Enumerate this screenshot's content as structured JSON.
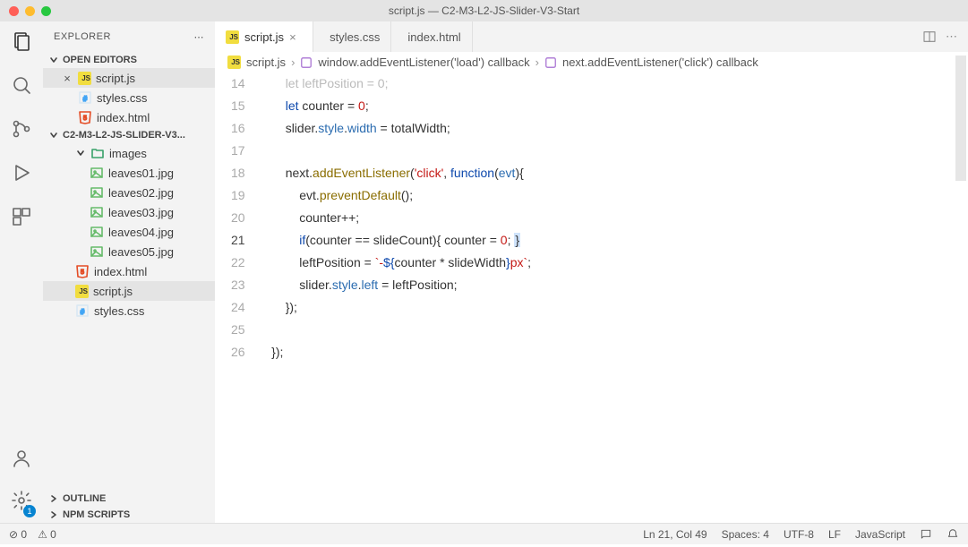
{
  "window": {
    "title": "script.js — C2-M3-L2-JS-Slider-V3-Start"
  },
  "sidebar": {
    "header": "EXPLORER",
    "openEditors": "OPEN EDITORS",
    "project": "C2-M3-L2-JS-SLIDER-V3...",
    "outline": "OUTLINE",
    "npm": "NPM SCRIPTS",
    "open": [
      {
        "name": "script.js",
        "type": "js",
        "close": true
      },
      {
        "name": "styles.css",
        "type": "css"
      },
      {
        "name": "index.html",
        "type": "html"
      }
    ],
    "tree": [
      {
        "name": "images",
        "type": "folder",
        "depth": 2,
        "chev": true
      },
      {
        "name": "leaves01.jpg",
        "type": "img",
        "depth": 3
      },
      {
        "name": "leaves02.jpg",
        "type": "img",
        "depth": 3
      },
      {
        "name": "leaves03.jpg",
        "type": "img",
        "depth": 3
      },
      {
        "name": "leaves04.jpg",
        "type": "img",
        "depth": 3
      },
      {
        "name": "leaves05.jpg",
        "type": "img",
        "depth": 3
      },
      {
        "name": "index.html",
        "type": "html",
        "depth": 2
      },
      {
        "name": "script.js",
        "type": "js",
        "depth": 2,
        "sel": true
      },
      {
        "name": "styles.css",
        "type": "css",
        "depth": 2
      }
    ]
  },
  "tabs": [
    {
      "label": "script.js",
      "type": "js",
      "active": true,
      "close": true
    },
    {
      "label": "styles.css",
      "type": "css"
    },
    {
      "label": "index.html",
      "type": "html"
    }
  ],
  "breadcrumb": {
    "file": "script.js",
    "sym1": "window.addEventListener('load') callback",
    "sym2": "next.addEventListener('click') callback"
  },
  "code": {
    "lines": [
      14,
      15,
      16,
      17,
      18,
      19,
      20,
      21,
      22,
      23,
      24,
      25,
      26
    ]
  },
  "status": {
    "errors": "0",
    "warnings": "0",
    "pos": "Ln 21, Col 49",
    "spaces": "Spaces: 4",
    "enc": "UTF-8",
    "eol": "LF",
    "lang": "JavaScript"
  },
  "badge": "1"
}
